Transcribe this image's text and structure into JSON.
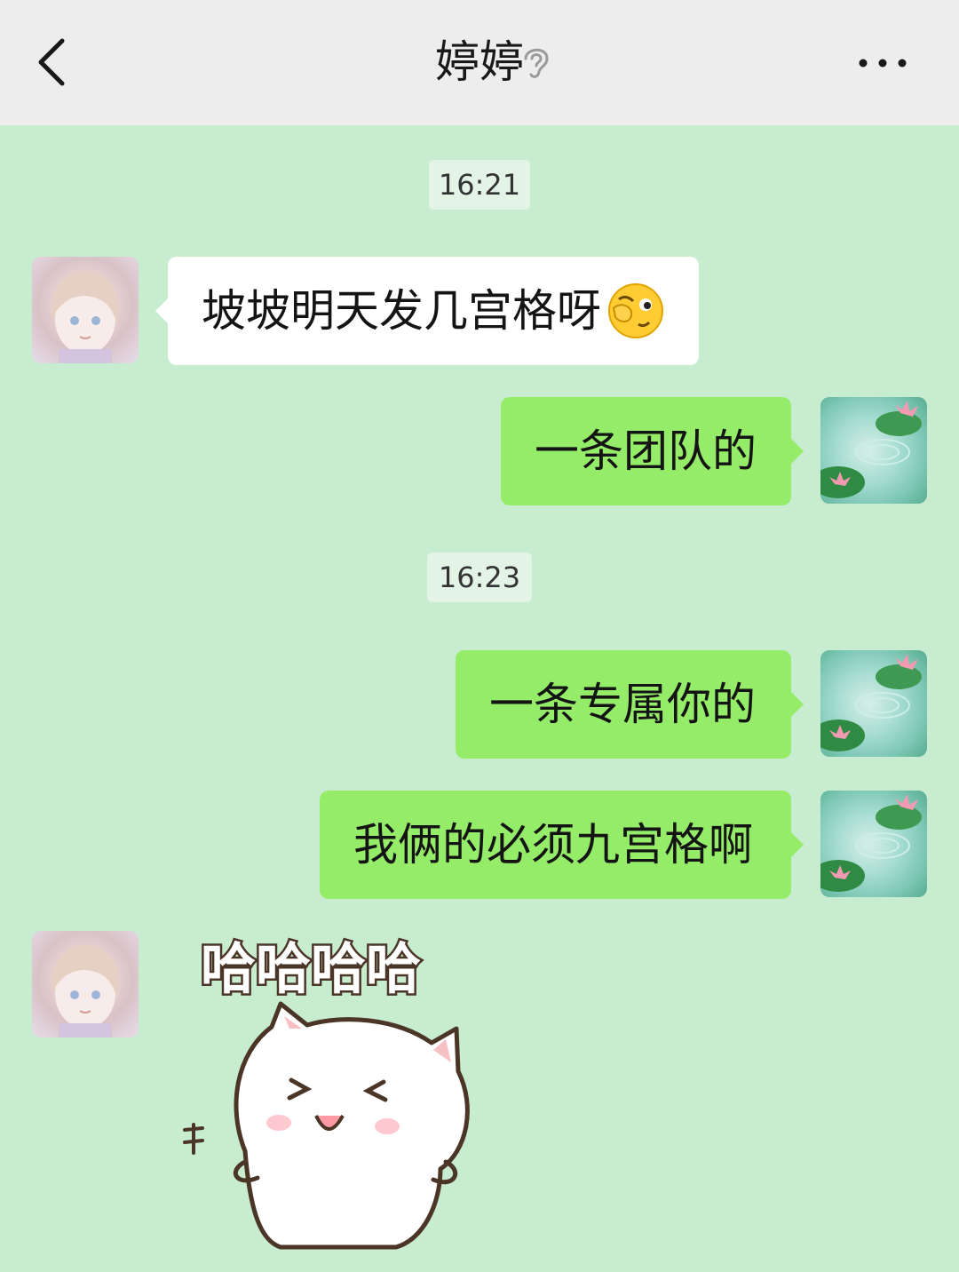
{
  "header": {
    "title": "婷婷",
    "back_icon": "chevron-left-icon",
    "ear_icon": "ear-icon",
    "more_icon": "more-icon"
  },
  "messages": [
    {
      "type": "time",
      "text": "16:21"
    },
    {
      "type": "text",
      "side": "left",
      "text": "坡坡明天发几宫格呀",
      "emoji": "wink-face"
    },
    {
      "type": "text",
      "side": "right",
      "text": "一条团队的"
    },
    {
      "type": "time",
      "text": "16:23"
    },
    {
      "type": "text",
      "side": "right",
      "text": "一条专属你的"
    },
    {
      "type": "text",
      "side": "right",
      "text": "我俩的必须九宫格啊"
    },
    {
      "type": "sticker",
      "side": "left",
      "text": "哈哈哈哈",
      "sticker_name": "laughing-cat-sticker"
    }
  ],
  "colors": {
    "chat_bg": "#c8ecd0",
    "topbar_bg": "#ededed",
    "bubble_right": "#95ec69",
    "bubble_left": "#ffffff"
  }
}
